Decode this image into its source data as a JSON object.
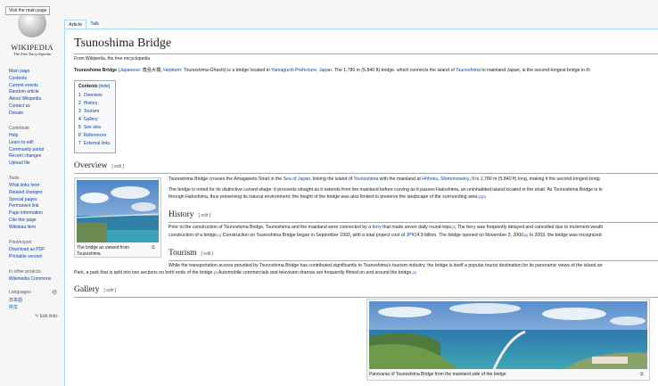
{
  "sidebar": {
    "logo_tooltip": "Visit the main page",
    "logo_word": "WIKIPEDIA",
    "logo_sub": "The Free Encyclopedia",
    "nav_items": [
      "Main page",
      "Contents",
      "Current events",
      "Random article",
      "About Wikipedia",
      "Contact us",
      "Donate"
    ],
    "contribute_heading": "Contribute",
    "contribute_items": [
      "Help",
      "Learn to edit",
      "Community portal",
      "Recent changes",
      "Upload file"
    ],
    "tools_heading": "Tools",
    "tools_items": [
      "What links here",
      "Related changes",
      "Special pages",
      "Permanent link",
      "Page information",
      "Cite this page",
      "Wikidata item"
    ],
    "print_heading": "Print/export",
    "print_items": [
      "Download as PDF",
      "Printable version"
    ],
    "other_heading": "In other projects",
    "other_items": [
      "Wikimedia Commons"
    ],
    "languages_heading": "Languages",
    "language_items": [
      "日本語",
      "中文"
    ],
    "edit_links": "✎ Edit links"
  },
  "tabs": {
    "article": "Article",
    "talk": "Talk"
  },
  "article": {
    "title": "Tsunoshima Bridge",
    "site_sub": "From Wikipedia, the free encyclopedia",
    "lead_1": "Tsunoshima Bridge",
    "lead_2": " (",
    "lead_japanese": "Japanese",
    "lead_3": ": 角島大橋, ",
    "lead_hepburn": "Hepburn",
    "lead_4": ": ",
    "lead_romaji": "Tsunoshima-Ōhashi",
    "lead_5": ") is a bridge located in ",
    "lead_yamaguchi": "Yamaguchi Prefecture",
    "lead_6": ", ",
    "lead_japan": "Japan",
    "lead_7": ". The 1,780 m (5,840 ft) bridge, which connects the island of ",
    "lead_tsunoshima": "Tsunoshima",
    "lead_8": " to mainland Japan, is the second-longest bridge in th"
  },
  "toc": {
    "title": "Contents",
    "hide": "[hide]",
    "items": [
      {
        "num": "1",
        "label": "Overview"
      },
      {
        "num": "2",
        "label": "History"
      },
      {
        "num": "3",
        "label": "Tourism"
      },
      {
        "num": "4",
        "label": "Gallery"
      },
      {
        "num": "5",
        "label": "See also"
      },
      {
        "num": "6",
        "label": "References"
      },
      {
        "num": "7",
        "label": "External links"
      }
    ]
  },
  "overview": {
    "heading": "Overview",
    "edit": "[ edit ]",
    "p1_a": "Tsunoshima Bridge crosses the Amagaseto Strait in the ",
    "p1_sea": "Sea of Japan",
    "p1_b": ", linking the island of ",
    "p1_tsuno": "Tsunoshima",
    "p1_c": " with the mainland at ",
    "p1_hohoku": "Hōhoku",
    "p1_d": ", ",
    "p1_shimo": "Shimonoseki",
    "p1_ref": "[1]",
    "p1_e": " It is 1,780 m (5,840 ft) long, making it the second-longest bridg",
    "p2_line1": "The bridge is noted for its distinctive curved shape: it proceeds straight as it extends from the mainland before curving as it passes Hatoshima, an uninhabited island located in the strait. As Tsunoshima Bridge is lo",
    "p2_line2": "through Hatoshima, thus preserving its natural environment; the height of the bridge was also limited to preserve the landscape of the surrounding area.",
    "p2_ref": "[2][3]",
    "thumb_caption": "The bridge as viewed from Tsunoshima"
  },
  "history": {
    "heading": "History",
    "edit": "[ edit ]",
    "l1_a": "Prior to the construction of Tsunoshima Bridge, Tsunoshima and the mainland were connected by a ",
    "l1_ferry": "ferry",
    "l1_b": " that made seven daily round-trips.",
    "l1_ref": "[3]",
    "l1_c": " The ferry was frequently delayed and cancelled due to inclement weath",
    "l2_a": "construction of a bridge.",
    "l2_ref1": "[1]",
    "l2_b": " Construction on Tsunoshima Bridge began in September 1993, with a total project cost of ",
    "l2_jpy": "JP¥",
    "l2_c": "14.9 billion. The bridge opened on November 3, 2000.",
    "l2_ref2": "[6]",
    "l2_d": " In 2003, the bridge was recognized"
  },
  "tourism": {
    "heading": "Tourism",
    "edit": "[ edit ]",
    "l1": "While the transportation access provided by Tsunoshima Bridge has contributed significantly to Tsunoshima's tourism industry, the bridge is itself a popular tourist destination for its panoramic views of the island an",
    "l2_a": "Park, a park that is split into two sections on both ends of the bridge.",
    "l2_ref1": "[2]",
    "l2_b": " Automobile commercials and television dramas are frequently filmed on and around the bridge.",
    "l2_ref2": "[3]"
  },
  "gallery": {
    "heading": "Gallery",
    "edit": "[ edit ]",
    "caption": "Panorama of Tsunoshima Bridge from the mainland side of the bridge"
  },
  "colors": {
    "link": "#0645ad",
    "border": "#a7d7f9",
    "sky": "#6fa3d9",
    "sea": "#3d7fb0"
  }
}
